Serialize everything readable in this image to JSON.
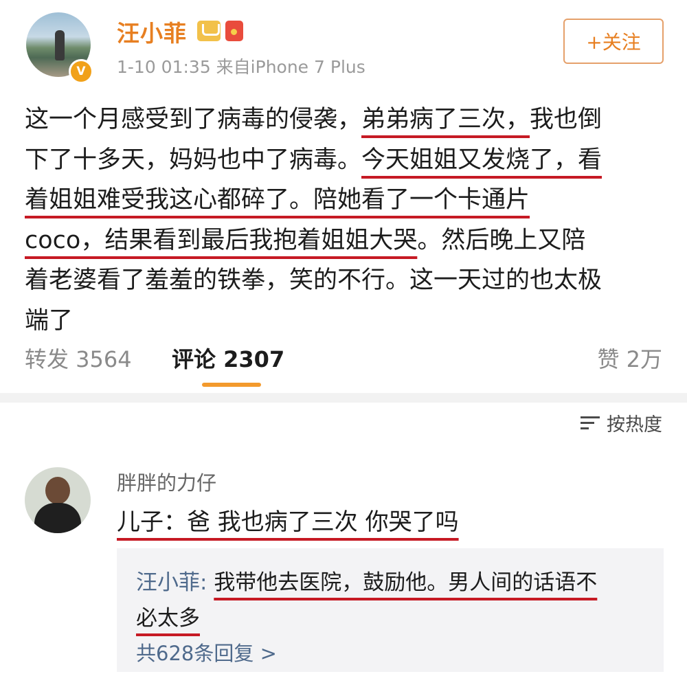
{
  "post": {
    "username": "汪小菲",
    "verified_mark": "V",
    "meta": "1-10 01:35  来自iPhone 7 Plus",
    "follow_label": "+关注",
    "text": {
      "l1_a": "这一个月感受到了病毒的侵袭，",
      "l1_b": "弟弟病了三次，",
      "l1_c": "我也倒",
      "l2_a": "下了十多天，妈妈也中了病毒。",
      "l2_b": "今天姐姐又发烧了，看",
      "l3_a": "着姐姐难受我这心都碎了。",
      "l3_b": "陪她看了一个卡通片",
      "l4_a": "coco，结果看到最后我抱着姐姐大哭",
      "l4_b": "。然后晚上又陪",
      "l5": "着老婆看了羞羞的铁拳，笑的不行。这一天过的也太极",
      "l6": "端了"
    }
  },
  "actions": {
    "repost": "转发 3564",
    "comment": "评论 2307",
    "like": "赞 2万"
  },
  "sort": {
    "label": "按热度"
  },
  "comment": {
    "username": "胖胖的力仔",
    "text": "儿子：爸 我也病了三次 你哭了吗",
    "reply": {
      "name": "汪小菲:",
      "text_1": "我带他去医院，鼓励他。男人间的话语不",
      "text_2": "必太多"
    },
    "more_replies": "共628条回复 >"
  },
  "colors": {
    "accent": "#e77f21",
    "underline": "#c61a24",
    "link": "#4f6a8c"
  }
}
